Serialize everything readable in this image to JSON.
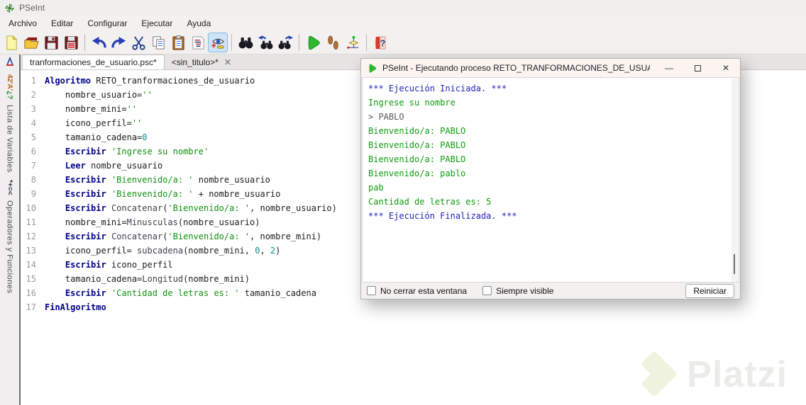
{
  "window": {
    "title": "PSeInt"
  },
  "menubar": {
    "items": [
      "Archivo",
      "Editar",
      "Configurar",
      "Ejecutar",
      "Ayuda"
    ]
  },
  "toolbar": {
    "pressed": "syntax-highlight",
    "groups": [
      [
        "new-file",
        "open-file",
        "save-file",
        "save-all"
      ],
      [
        "undo",
        "redo",
        "cut",
        "copy",
        "paste",
        "format-source",
        "syntax-highlight"
      ],
      [
        "find",
        "find-prev",
        "find-next"
      ],
      [
        "run",
        "run-step",
        "flowchart"
      ],
      [
        "help"
      ]
    ]
  },
  "tabs": [
    {
      "label": "tranformaciones_de_usuario.psc*",
      "active": true
    },
    {
      "label": "<sin_titulo>*",
      "active": false,
      "closable": true
    }
  ],
  "sidebar": {
    "panels": [
      {
        "icon": "variables-icon",
        "glyph": "42'A'",
        "glyph2": "¿?",
        "label": "Lista de Variables"
      },
      {
        "icon": "operators-icon",
        "glyph": "*+=<",
        "glyph2": "",
        "label": "Operadores y Funciones"
      }
    ]
  },
  "editor": {
    "lines": [
      {
        "n": "1",
        "seg": [
          {
            "s": "kw",
            "t": "Algoritmo"
          },
          {
            "s": "pl",
            "t": " RETO_tranformaciones_de_usuario"
          }
        ]
      },
      {
        "n": "2",
        "seg": [
          {
            "s": "pl",
            "t": "    nombre_usuario="
          },
          {
            "s": "str",
            "t": "''"
          }
        ]
      },
      {
        "n": "3",
        "seg": [
          {
            "s": "pl",
            "t": "    nombre_mini="
          },
          {
            "s": "str",
            "t": "''"
          }
        ]
      },
      {
        "n": "4",
        "seg": [
          {
            "s": "pl",
            "t": "    icono_perfil="
          },
          {
            "s": "str",
            "t": "''"
          }
        ]
      },
      {
        "n": "5",
        "seg": [
          {
            "s": "pl",
            "t": "    tamanio_cadena="
          },
          {
            "s": "num",
            "t": "0"
          }
        ]
      },
      {
        "n": "6",
        "seg": [
          {
            "s": "pl",
            "t": "    "
          },
          {
            "s": "kw",
            "t": "Escribir"
          },
          {
            "s": "pl",
            "t": " "
          },
          {
            "s": "str",
            "t": "'Ingrese su nombre'"
          }
        ]
      },
      {
        "n": "7",
        "seg": [
          {
            "s": "pl",
            "t": "    "
          },
          {
            "s": "kw",
            "t": "Leer"
          },
          {
            "s": "pl",
            "t": " nombre_usuario"
          }
        ]
      },
      {
        "n": "8",
        "seg": [
          {
            "s": "pl",
            "t": "    "
          },
          {
            "s": "kw",
            "t": "Escribir"
          },
          {
            "s": "pl",
            "t": " "
          },
          {
            "s": "str",
            "t": "'Bienvenido/a: '"
          },
          {
            "s": "pl",
            "t": " nombre_usuario"
          }
        ]
      },
      {
        "n": "9",
        "seg": [
          {
            "s": "pl",
            "t": "    "
          },
          {
            "s": "kw",
            "t": "Escribir"
          },
          {
            "s": "pl",
            "t": " "
          },
          {
            "s": "str",
            "t": "'Bienvenido/a: '"
          },
          {
            "s": "pl",
            "t": " + nombre_usuario"
          }
        ]
      },
      {
        "n": "10",
        "seg": [
          {
            "s": "pl",
            "t": "    "
          },
          {
            "s": "kw",
            "t": "Escribir"
          },
          {
            "s": "pl",
            "t": " "
          },
          {
            "s": "fn",
            "t": "Concatenar"
          },
          {
            "s": "pl",
            "t": "("
          },
          {
            "s": "str",
            "t": "'Bienvenido/a: '"
          },
          {
            "s": "pl",
            "t": ", nombre_usuario)"
          }
        ]
      },
      {
        "n": "11",
        "seg": [
          {
            "s": "pl",
            "t": "    nombre_mini="
          },
          {
            "s": "fn",
            "t": "Minusculas"
          },
          {
            "s": "pl",
            "t": "(nombre_usuario)"
          }
        ]
      },
      {
        "n": "12",
        "seg": [
          {
            "s": "pl",
            "t": "    "
          },
          {
            "s": "kw",
            "t": "Escribir"
          },
          {
            "s": "pl",
            "t": " "
          },
          {
            "s": "fn",
            "t": "Concatenar"
          },
          {
            "s": "pl",
            "t": "("
          },
          {
            "s": "str",
            "t": "'Bienvenido/a: '"
          },
          {
            "s": "pl",
            "t": ", nombre_mini)"
          }
        ]
      },
      {
        "n": "13",
        "seg": [
          {
            "s": "pl",
            "t": "    icono_perfil= "
          },
          {
            "s": "fn",
            "t": "subcadena"
          },
          {
            "s": "pl",
            "t": "(nombre_mini, "
          },
          {
            "s": "num",
            "t": "0"
          },
          {
            "s": "pl",
            "t": ", "
          },
          {
            "s": "num",
            "t": "2"
          },
          {
            "s": "pl",
            "t": ")"
          }
        ]
      },
      {
        "n": "14",
        "seg": [
          {
            "s": "pl",
            "t": "    "
          },
          {
            "s": "kw",
            "t": "Escribir"
          },
          {
            "s": "pl",
            "t": " icono_perfil"
          }
        ]
      },
      {
        "n": "15",
        "seg": [
          {
            "s": "pl",
            "t": "    tamanio_cadena="
          },
          {
            "s": "fn",
            "t": "Longitud"
          },
          {
            "s": "pl",
            "t": "(nombre_mini)"
          }
        ]
      },
      {
        "n": "16",
        "seg": [
          {
            "s": "pl",
            "t": "    "
          },
          {
            "s": "kw",
            "t": "Escribir"
          },
          {
            "s": "pl",
            "t": " "
          },
          {
            "s": "str",
            "t": "'Cantidad de letras es: '"
          },
          {
            "s": "pl",
            "t": " tamanio_cadena"
          }
        ]
      },
      {
        "n": "17",
        "seg": [
          {
            "s": "kw",
            "t": "FinAlgoritmo"
          }
        ]
      }
    ]
  },
  "dialog": {
    "title": "PSeInt - Ejecutando proceso RETO_TRANFORMACIONES_DE_USUA...",
    "console_lines": [
      {
        "kind": "info",
        "text": "*** Ejecución Iniciada. ***"
      },
      {
        "kind": "out",
        "text": "Ingrese su nombre"
      },
      {
        "kind": "in",
        "text": "> PABLO"
      },
      {
        "kind": "out",
        "text": "Bienvenido/a: PABLO"
      },
      {
        "kind": "out",
        "text": "Bienvenido/a: PABLO"
      },
      {
        "kind": "out",
        "text": "Bienvenido/a: PABLO"
      },
      {
        "kind": "out",
        "text": "Bienvenido/a: pablo"
      },
      {
        "kind": "out",
        "text": "pab"
      },
      {
        "kind": "out",
        "text": "Cantidad de letras es: 5"
      },
      {
        "kind": "info",
        "text": "*** Ejecución Finalizada. ***"
      }
    ],
    "checkbox1": "No cerrar esta ventana",
    "checkbox2": "Siempre visible",
    "restart_label": "Reiniciar"
  },
  "watermark": {
    "text": "Platzi"
  },
  "colors": {
    "keyword": "#00008b",
    "string": "#119111",
    "number": "#0d8f8f",
    "console_out": "#0f9b0f",
    "console_info": "#2323b8",
    "run_green": "#2eb82e"
  }
}
